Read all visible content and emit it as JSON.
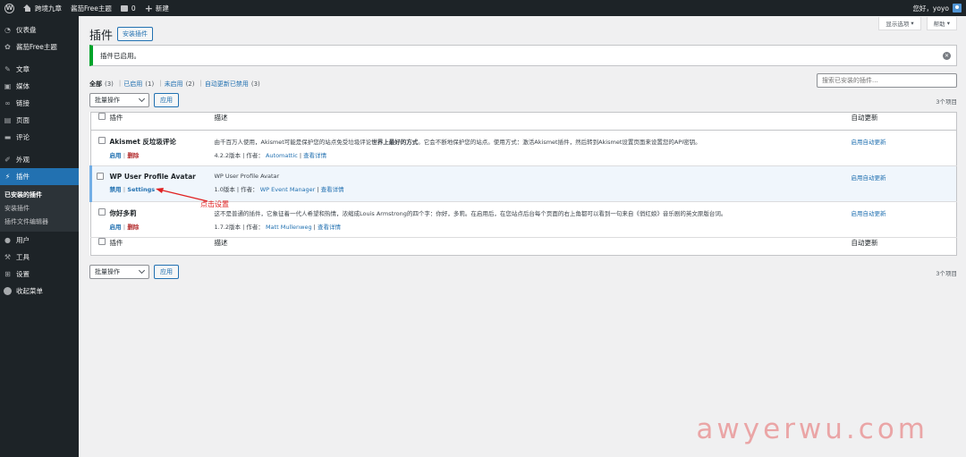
{
  "adminbar": {
    "site_name": "跨境九章",
    "theme": "酱茄Free主题",
    "comments_count": "0",
    "new_label": "新建",
    "greeting": "您好，yoyo"
  },
  "sidebar": {
    "items": [
      {
        "label": "仪表盘",
        "icon": "dashboard-icon"
      },
      {
        "label": "酱茄Free主题",
        "icon": "gear-icon"
      },
      {
        "label": "文章",
        "icon": "pin-icon"
      },
      {
        "label": "媒体",
        "icon": "media-icon"
      },
      {
        "label": "链接",
        "icon": "link-icon"
      },
      {
        "label": "页面",
        "icon": "page-icon"
      },
      {
        "label": "评论",
        "icon": "comment-icon"
      },
      {
        "label": "外观",
        "icon": "brush-icon"
      },
      {
        "label": "插件",
        "icon": "plugin-icon"
      },
      {
        "label": "用户",
        "icon": "user-icon"
      },
      {
        "label": "工具",
        "icon": "wrench-icon"
      },
      {
        "label": "设置",
        "icon": "settings-icon"
      },
      {
        "label": "收起菜单",
        "icon": "collapse-icon"
      }
    ],
    "submenu": [
      "已安装的插件",
      "安装插件",
      "插件文件编辑器"
    ]
  },
  "header": {
    "screen_options": "显示选项",
    "help": "帮助",
    "title": "插件",
    "add_button": "安装插件"
  },
  "notice": {
    "text": "插件已启用。"
  },
  "filters": {
    "all": "全部",
    "all_count": "(3)",
    "active": "已启用",
    "active_count": "(1)",
    "inactive": "未启用",
    "inactive_count": "(2)",
    "autoupdate": "自动更新已禁用",
    "autoupdate_count": "(3)",
    "sep": "|"
  },
  "search": {
    "placeholder": "搜索已安装的插件..."
  },
  "tablenav": {
    "bulk": "批量操作",
    "apply": "应用",
    "count": "3个项目"
  },
  "table": {
    "col_plugin": "插件",
    "col_desc": "描述",
    "col_auto": "自动更新",
    "rows": [
      {
        "name": "Akismet 反垃圾评论",
        "action1": "启用",
        "action2": "删除",
        "desc_pre": "由千百万人使用，Akismet可能是保护您的站点免受垃圾评论",
        "desc_bold": "世界上最好的方式",
        "desc_post": "。它会不断地保护您的站点。使用方式：激活Akismet插件，然后转到Akismet设置页面来设置您的API密钥。",
        "version": "4.2.2版本",
        "author_label": "作者：",
        "author": "Automattic",
        "details": "查看详情",
        "auto": "启用自动更新"
      },
      {
        "name": "WP User Profile Avatar",
        "action1": "禁用",
        "action2": "Settings",
        "desc_pre": "WP User Profile Avatar",
        "desc_bold": "",
        "desc_post": "",
        "version": "1.0版本",
        "author_label": "作者：",
        "author": "WP Event Manager",
        "details": "查看详情",
        "auto": "启用自动更新"
      },
      {
        "name": "你好多莉",
        "action1": "启用",
        "action2": "删除",
        "desc_pre": "这不是普通的插件，它象征着一代人希望和热情，浓缩成Louis Armstrong的四个字：你好，多莉。在启用后，在您站点后台每个页面的右上角都可以看到一句来自《俏红娘》音乐剧的英文原版台词。",
        "desc_bold": "",
        "desc_post": "",
        "version": "1.7.2版本",
        "author_label": "作者：",
        "author": "Matt Mullenweg",
        "details": "查看详情",
        "auto": "启用自动更新"
      }
    ]
  },
  "annotation": {
    "text": "点击设置",
    "color": "#e02020"
  },
  "watermark": "awyerwu.com"
}
